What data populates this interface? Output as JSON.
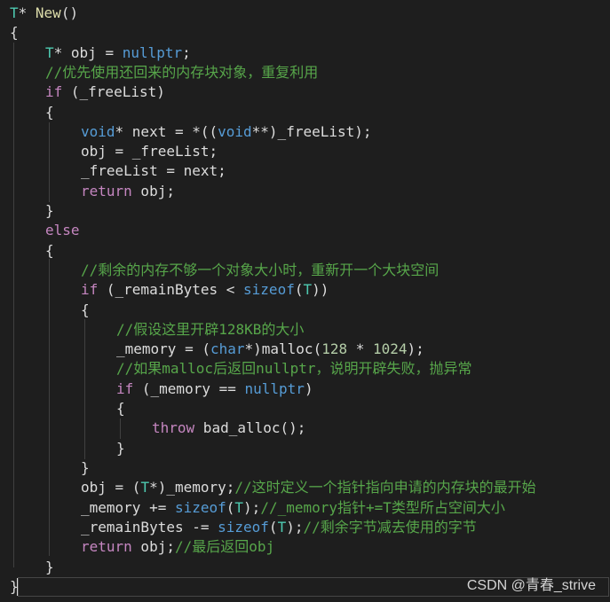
{
  "colors": {
    "background": "#1e1e1e",
    "keyword": "#569cd6",
    "type": "#4ec9b0",
    "function": "#dcdcaa",
    "identifier": "#dcdcdc",
    "number": "#b5cea8",
    "comment": "#57a64a"
  },
  "watermark": "CSDN @青春_strive",
  "code_lines": [
    [
      [
        "type",
        "T"
      ],
      [
        "op",
        "* "
      ],
      [
        "fn",
        "New"
      ],
      [
        "op",
        "()"
      ]
    ],
    [
      [
        "op",
        "{"
      ]
    ],
    [
      [
        "type",
        "T"
      ],
      [
        "op",
        "* obj = "
      ],
      [
        "kw",
        "nullptr"
      ],
      [
        "op",
        ";"
      ]
    ],
    [
      [
        "cmt",
        "//优先使用还回来的内存块对象，重复利用"
      ]
    ],
    [
      [
        "ctl",
        "if"
      ],
      [
        "op",
        " (_freeList)"
      ]
    ],
    [
      [
        "op",
        "{"
      ]
    ],
    [
      [
        "kw",
        "void"
      ],
      [
        "op",
        "* next = *(("
      ],
      [
        "kw",
        "void"
      ],
      [
        "op",
        "**)_freeList);"
      ]
    ],
    [
      [
        "op",
        "obj = _freeList;"
      ]
    ],
    [
      [
        "op",
        "_freeList = next;"
      ]
    ],
    [
      [
        "ctl",
        "return"
      ],
      [
        "op",
        " obj;"
      ]
    ],
    [
      [
        "op",
        "}"
      ]
    ],
    [
      [
        "ctl",
        "else"
      ]
    ],
    [
      [
        "op",
        "{"
      ]
    ],
    [
      [
        "cmt",
        "//剩余的内存不够一个对象大小时，重新开一个大块空间"
      ]
    ],
    [
      [
        "ctl",
        "if"
      ],
      [
        "op",
        " (_remainBytes < "
      ],
      [
        "kw",
        "sizeof"
      ],
      [
        "op",
        "("
      ],
      [
        "type",
        "T"
      ],
      [
        "op",
        "))"
      ]
    ],
    [
      [
        "op",
        "{"
      ]
    ],
    [
      [
        "cmt",
        "//假设这里开辟128KB的大小"
      ]
    ],
    [
      [
        "op",
        "_memory = ("
      ],
      [
        "kw",
        "char"
      ],
      [
        "op",
        "*)malloc("
      ],
      [
        "num",
        "128"
      ],
      [
        "op",
        " * "
      ],
      [
        "num",
        "1024"
      ],
      [
        "op",
        ");"
      ]
    ],
    [
      [
        "cmt",
        "//如果malloc后返回nullptr，说明开辟失败，抛异常"
      ]
    ],
    [
      [
        "ctl",
        "if"
      ],
      [
        "op",
        " (_memory == "
      ],
      [
        "kw",
        "nullptr"
      ],
      [
        "op",
        ")"
      ]
    ],
    [
      [
        "op",
        "{"
      ]
    ],
    [
      [
        "ctl",
        "throw"
      ],
      [
        "op",
        " bad_alloc();"
      ]
    ],
    [
      [
        "op",
        "}"
      ]
    ],
    [
      [
        "op",
        "}"
      ]
    ],
    [
      [
        "op",
        "obj = ("
      ],
      [
        "type",
        "T"
      ],
      [
        "op",
        "*)_memory;"
      ],
      [
        "cmt",
        "//这时定义一个指针指向申请的内存块的最开始"
      ]
    ],
    [
      [
        "op",
        "_memory += "
      ],
      [
        "kw",
        "sizeof"
      ],
      [
        "op",
        "("
      ],
      [
        "type",
        "T"
      ],
      [
        "op",
        ");"
      ],
      [
        "cmt",
        "//_memory指针+=T类型所占空间大小"
      ]
    ],
    [
      [
        "op",
        "_remainBytes -= "
      ],
      [
        "kw",
        "sizeof"
      ],
      [
        "op",
        "("
      ],
      [
        "type",
        "T"
      ],
      [
        "op",
        ");"
      ],
      [
        "cmt",
        "//剩余字节减去使用的字节"
      ]
    ],
    [
      [
        "ctl",
        "return"
      ],
      [
        "op",
        " obj;"
      ],
      [
        "cmt",
        "//最后返回obj"
      ]
    ],
    [
      [
        "op",
        "}"
      ]
    ],
    [
      [
        "op",
        "}"
      ]
    ]
  ]
}
